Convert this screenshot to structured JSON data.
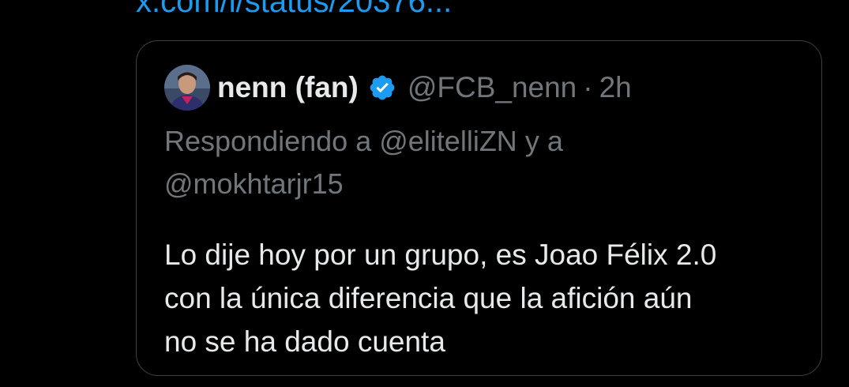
{
  "link": {
    "text": "x.com/i/status/20376..."
  },
  "quote": {
    "author": {
      "display_name": "nenn (fan)",
      "verified_icon": "verified-badge-icon",
      "handle": "@FCB_nenn",
      "separator": "·",
      "time": "2h"
    },
    "reply_context": {
      "prefix": "Respondiendo a",
      "mention_1": "@elitelliZN",
      "conjunction": "y a",
      "mention_2": "@mokhtarjr15"
    },
    "body_lines": [
      "Lo dije hoy por un grupo, es Joao Félix 2.0",
      "con la única diferencia que la afición aún",
      "no se ha dado cuenta"
    ]
  },
  "colors": {
    "background": "#000000",
    "link": "#1d9bf0",
    "primary_text": "#e7e9ea",
    "secondary_text": "#71767b",
    "border": "#3e4144",
    "verified": "#1d9bf0"
  }
}
